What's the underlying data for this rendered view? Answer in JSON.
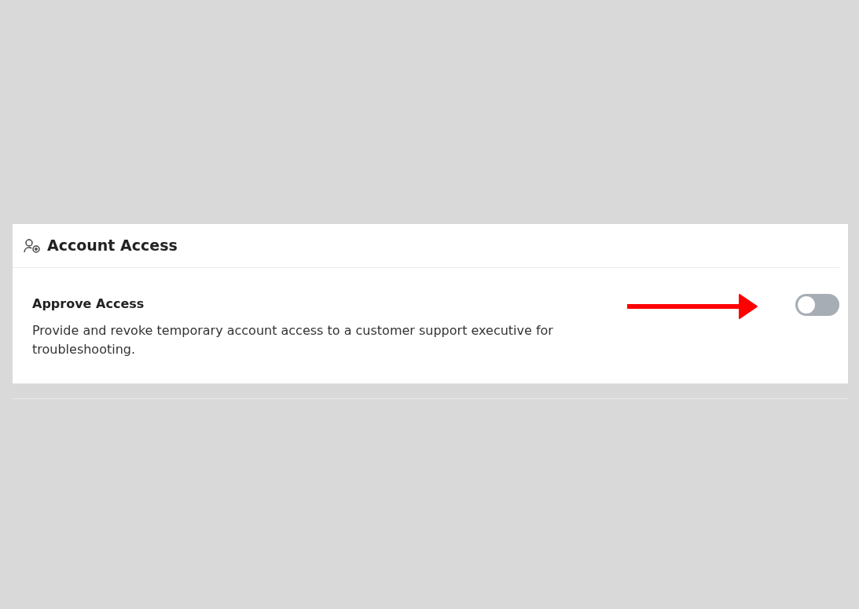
{
  "panel": {
    "title": "Account Access"
  },
  "setting": {
    "label": "Approve Access",
    "description": "Provide and revoke temporary account access to a customer support executive for troubleshooting.",
    "on": false
  }
}
